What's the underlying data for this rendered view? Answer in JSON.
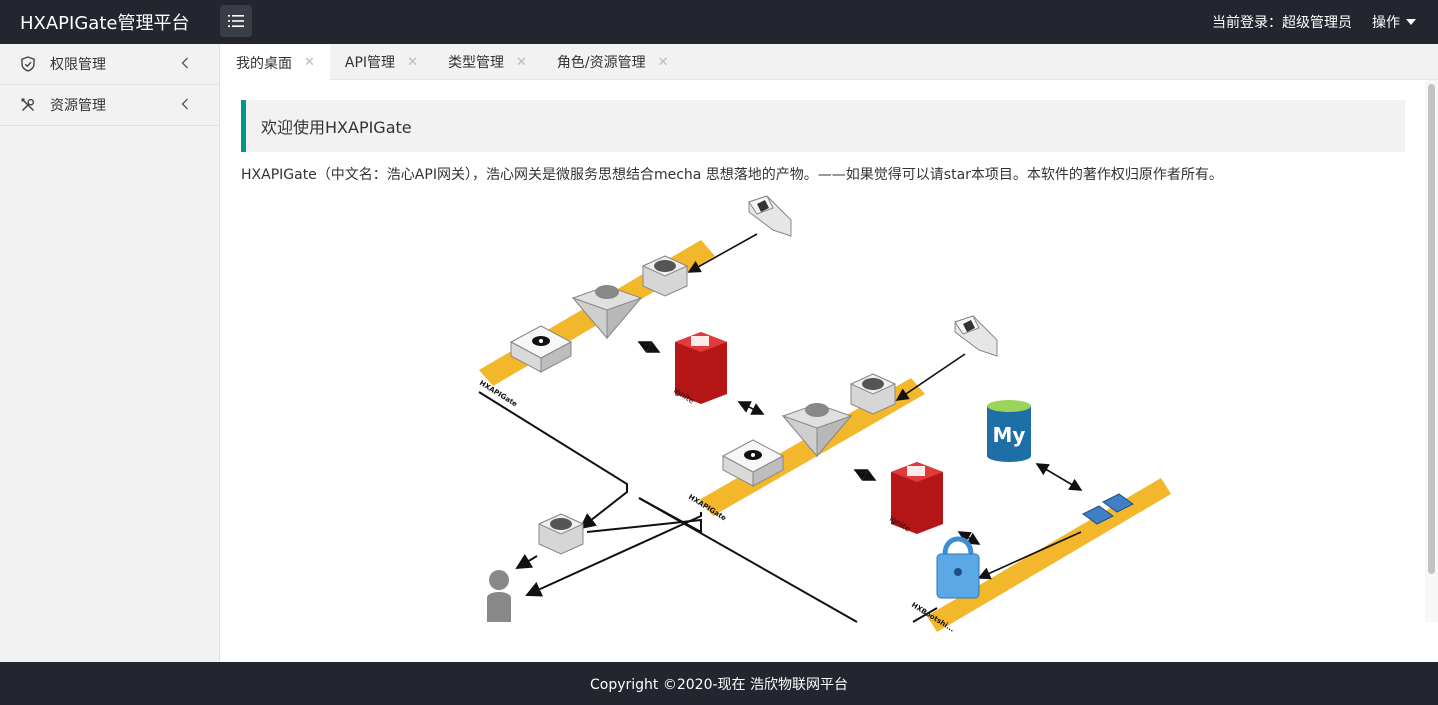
{
  "header": {
    "logo": "HXAPIGate管理平台",
    "current_user": "当前登录：超级管理员",
    "operations": "操作"
  },
  "sidebar": {
    "items": [
      {
        "label": "权限管理",
        "icon": "shield-icon"
      },
      {
        "label": "资源管理",
        "icon": "tools-icon"
      }
    ]
  },
  "tabs": [
    {
      "label": "我的桌面",
      "active": true
    },
    {
      "label": "API管理"
    },
    {
      "label": "类型管理"
    },
    {
      "label": "角色/资源管理"
    }
  ],
  "main": {
    "welcome": "欢迎使用HXAPIGate",
    "description": "HXAPIGate（中文名：浩心API网关），浩心网关是微服务思想结合mecha 思想落地的产物。——如果觉得可以请star本项目。本软件的著作权归原作者所有。",
    "diagram": {
      "labels": {
        "gateway_1": "HXAPIGate",
        "gateway_2": "HXAPIGate",
        "ignite_1": "ignite",
        "ignite_2": "ignite",
        "mysql": "My",
        "bootstrap": "HXBootshi..."
      }
    }
  },
  "footer": {
    "copyright": "Copyright ©2020-现在 浩欣物联网平台"
  },
  "colors": {
    "header_bg": "#23262e",
    "accent": "#009688",
    "belt": "#f3b72c",
    "ignite_red": "#c41a1a",
    "mysql_blue": "#1e6fa6"
  }
}
